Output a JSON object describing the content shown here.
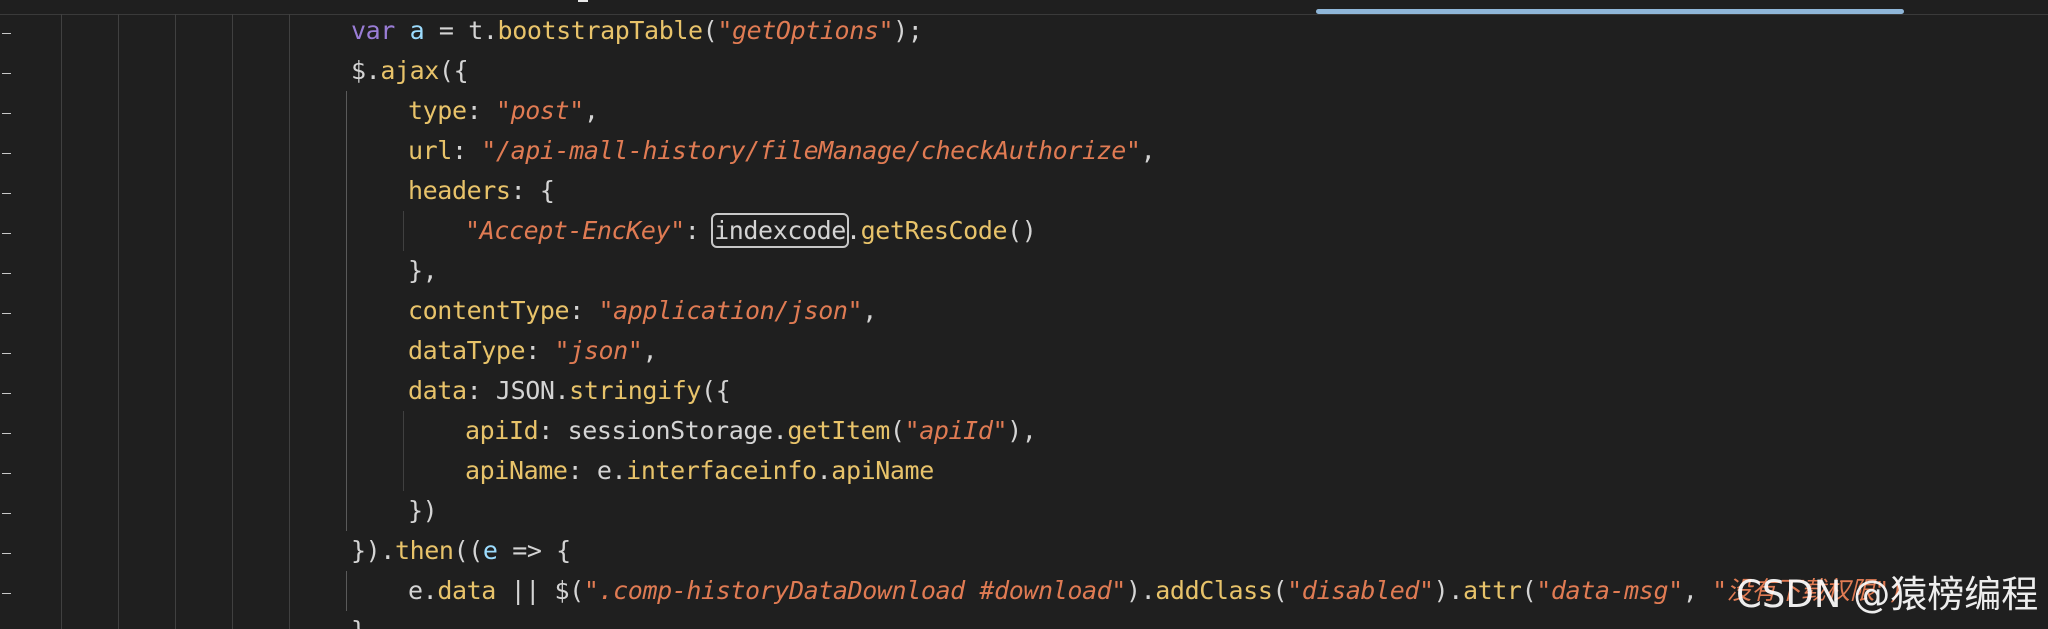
{
  "code": {
    "lines": [
      {
        "indent": 0,
        "tokens": [
          {
            "t": "var",
            "c": "kw"
          },
          {
            "t": " "
          },
          {
            "t": "a",
            "c": "var"
          },
          {
            "t": " = t."
          },
          {
            "t": "bootstrapTable",
            "c": "method"
          },
          {
            "t": "("
          },
          {
            "t": "\"getOptions\"",
            "c": "str"
          },
          {
            "t": ");"
          }
        ]
      },
      {
        "indent": 0,
        "tokens": [
          {
            "t": "$."
          },
          {
            "t": "ajax",
            "c": "method"
          },
          {
            "t": "({"
          }
        ]
      },
      {
        "indent": 1,
        "tokens": [
          {
            "t": "type",
            "c": "prop"
          },
          {
            "t": ": "
          },
          {
            "t": "\"post\"",
            "c": "str"
          },
          {
            "t": ","
          }
        ]
      },
      {
        "indent": 1,
        "tokens": [
          {
            "t": "url",
            "c": "prop"
          },
          {
            "t": ": "
          },
          {
            "t": "\"/api-mall-history/fileManage/checkAuthorize\"",
            "c": "str"
          },
          {
            "t": ","
          }
        ]
      },
      {
        "indent": 1,
        "tokens": [
          {
            "t": "headers",
            "c": "prop"
          },
          {
            "t": ": {"
          }
        ]
      },
      {
        "indent": 2,
        "tokens": [
          {
            "t": "\"Accept-EncKey\"",
            "c": "str"
          },
          {
            "t": ": "
          },
          {
            "t": "indexcode",
            "c": "plain",
            "box": true
          },
          {
            "t": "."
          },
          {
            "t": "getResCode",
            "c": "method"
          },
          {
            "t": "()"
          }
        ]
      },
      {
        "indent": 1,
        "tokens": [
          {
            "t": "},"
          }
        ]
      },
      {
        "indent": 1,
        "tokens": [
          {
            "t": "contentType",
            "c": "prop"
          },
          {
            "t": ": "
          },
          {
            "t": "\"application/json\"",
            "c": "str"
          },
          {
            "t": ","
          }
        ]
      },
      {
        "indent": 1,
        "tokens": [
          {
            "t": "dataType",
            "c": "prop"
          },
          {
            "t": ": "
          },
          {
            "t": "\"json\"",
            "c": "str"
          },
          {
            "t": ","
          }
        ]
      },
      {
        "indent": 1,
        "tokens": [
          {
            "t": "data",
            "c": "prop"
          },
          {
            "t": ": JSON."
          },
          {
            "t": "stringify",
            "c": "method"
          },
          {
            "t": "({"
          }
        ]
      },
      {
        "indent": 2,
        "tokens": [
          {
            "t": "apiId",
            "c": "prop"
          },
          {
            "t": ": sessionStorage."
          },
          {
            "t": "getItem",
            "c": "method"
          },
          {
            "t": "("
          },
          {
            "t": "\"apiId\"",
            "c": "str"
          },
          {
            "t": "),"
          }
        ]
      },
      {
        "indent": 2,
        "tokens": [
          {
            "t": "apiName",
            "c": "prop"
          },
          {
            "t": ": e."
          },
          {
            "t": "interfaceinfo",
            "c": "method"
          },
          {
            "t": "."
          },
          {
            "t": "apiName",
            "c": "method"
          }
        ]
      },
      {
        "indent": 1,
        "tokens": [
          {
            "t": "})"
          }
        ]
      },
      {
        "indent": 0,
        "tokens": [
          {
            "t": "})."
          },
          {
            "t": "then",
            "c": "method"
          },
          {
            "t": "(("
          },
          {
            "t": "e",
            "c": "var"
          },
          {
            "t": " => {"
          }
        ]
      },
      {
        "indent": 1,
        "tokens": [
          {
            "t": "e."
          },
          {
            "t": "data",
            "c": "method"
          },
          {
            "t": " || $("
          },
          {
            "t": "\".comp-historyDataDownload #download\"",
            "c": "str"
          },
          {
            "t": ")."
          },
          {
            "t": "addClass",
            "c": "method"
          },
          {
            "t": "("
          },
          {
            "t": "\"disabled\"",
            "c": "str"
          },
          {
            "t": ")."
          },
          {
            "t": "attr",
            "c": "method"
          },
          {
            "t": "("
          },
          {
            "t": "\"data-msg\"",
            "c": "str"
          },
          {
            "t": ", "
          },
          {
            "t": "\"没有下载权限\")",
            "c": "str"
          }
        ]
      },
      {
        "indent": 0,
        "tokens": [
          {
            "t": "}"
          }
        ]
      }
    ]
  },
  "watermark": {
    "text": "CSDN @猿榜编程"
  },
  "colors": {
    "background": "#1f1f1f",
    "keyword": "#9a7dd6",
    "variable": "#9cdcfe",
    "property": "#e8c36a",
    "string": "#e07b53",
    "plain": "#d4d4d4",
    "scroll_thumb": "#8fb6d8"
  }
}
